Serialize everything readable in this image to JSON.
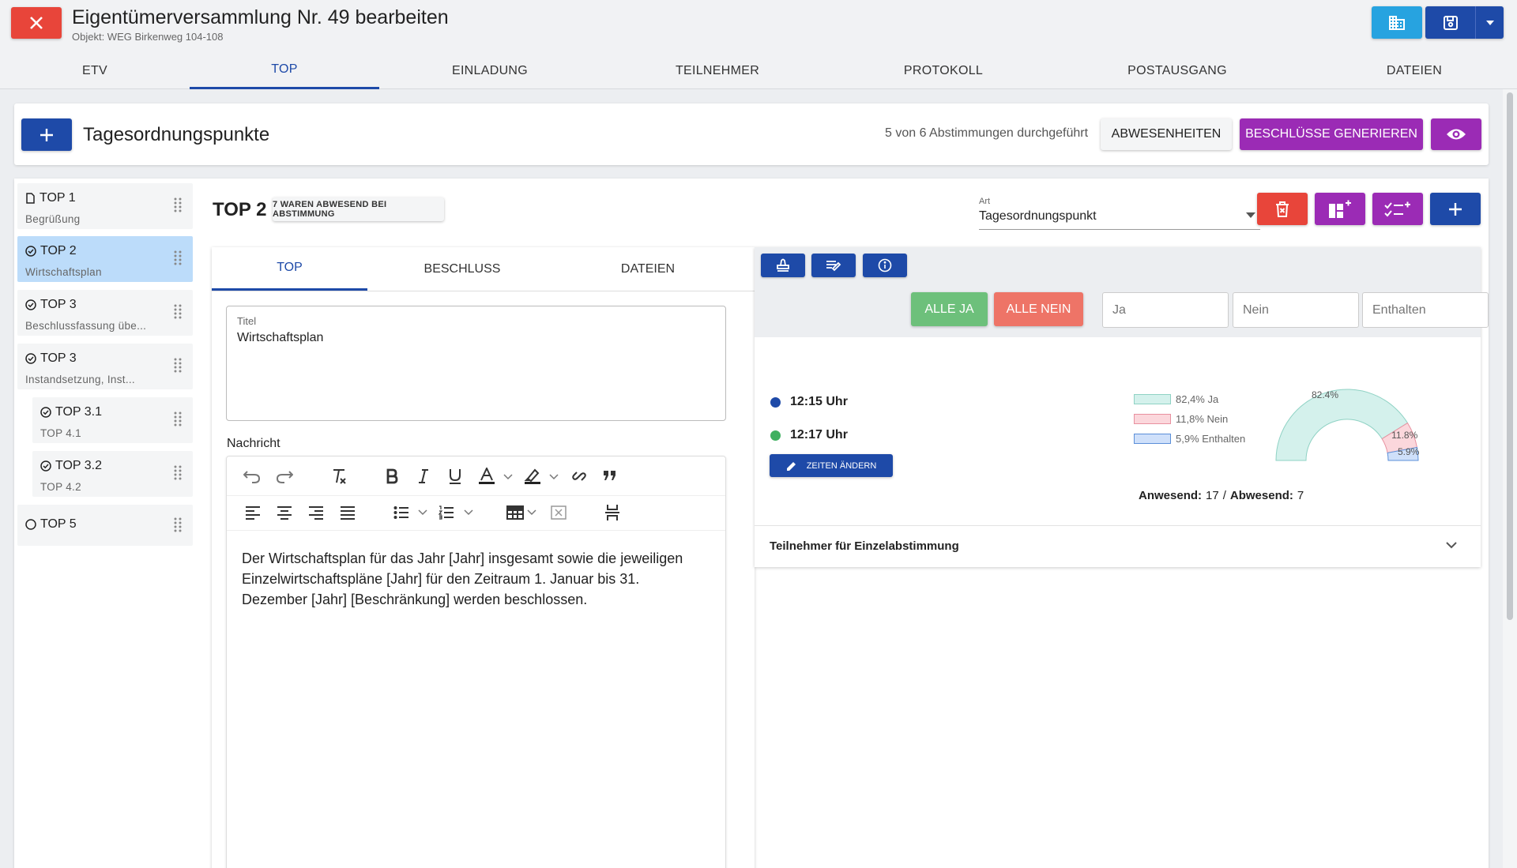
{
  "header": {
    "title": "Eigentümerversammlung Nr. 49 bearbeiten",
    "subtitle": "Objekt: WEG Birkenweg 104-108",
    "buttons": {
      "building_icon": "building-icon",
      "save_icon": "save-icon",
      "dropdown_icon": "caret-down-icon"
    }
  },
  "nav": {
    "tabs": [
      {
        "label": "ETV"
      },
      {
        "label": "TOP"
      },
      {
        "label": "EINLADUNG"
      },
      {
        "label": "TEILNEHMER"
      },
      {
        "label": "PROTOKOLL"
      },
      {
        "label": "POSTAUSGANG"
      },
      {
        "label": "DATEIEN"
      }
    ],
    "active": "TOP"
  },
  "toolbar": {
    "title": "Tagesordnungspunkte",
    "status": "5 von 6 Abstimmungen durchgeführt",
    "absences_label": "ABWESENHEITEN",
    "generate_label": "BESCHLÜSSE GENERIEREN"
  },
  "sidebar": {
    "items": [
      {
        "label": "TOP 1",
        "sub": "Begrüßung",
        "icon": "document-icon"
      },
      {
        "label": "TOP 2",
        "sub": "Wirtschaftsplan",
        "icon": "check-circle-icon",
        "active": true
      },
      {
        "label": "TOP 3",
        "sub": "Beschlussfassung übe...",
        "icon": "check-circle-icon"
      },
      {
        "label": "TOP 3",
        "sub": "Instandsetzung, Inst...",
        "icon": "check-circle-icon"
      },
      {
        "label": "TOP 3.1",
        "sub": "TOP 4.1",
        "icon": "check-circle-icon"
      },
      {
        "label": "TOP 3.2",
        "sub": "TOP 4.2",
        "icon": "check-circle-icon"
      },
      {
        "label": "TOP 5",
        "sub": "",
        "icon": "circle-icon"
      }
    ]
  },
  "detail": {
    "title": "TOP 2",
    "absent_chip": "7 WAREN ABWESEND BEI ABSTIMMUNG",
    "art_label": "Art",
    "art_value": "Tagesordnungspunkt",
    "tabs": [
      {
        "label": "TOP"
      },
      {
        "label": "BESCHLUSS"
      },
      {
        "label": "DATEIEN"
      }
    ],
    "title_field_label": "Titel",
    "title_field_value": "Wirtschaftsplan",
    "message_label": "Nachricht",
    "message_text": "Der Wirtschaftsplan für das Jahr [Jahr] insgesamt sowie die jeweiligen Einzelwirtschaftspläne [Jahr] für den Zeitraum 1. Januar bis 31. Dezember [Jahr] [Beschränkung] werden beschlossen."
  },
  "voting": {
    "all_yes": "ALLE JA",
    "all_no": "ALLE NEIN",
    "placeholders": {
      "yes": "Ja",
      "no": "Nein",
      "abstain": "Enthalten"
    },
    "time_start": "12:15 Uhr",
    "time_end": "12:17 Uhr",
    "change_times": "ZEITEN ÄNDERN",
    "present_label": "Anwesend:",
    "present_value": "17",
    "absent_label": "Abwesend:",
    "absent_value": "7",
    "separator": "/",
    "participants_label": "Teilnehmer für Einzelabstimmung",
    "colors": {
      "yes": "#d4f1ec",
      "no": "#fbd7dc",
      "abstain": "#cfe0fa",
      "start_dot": "#1e4aa8",
      "end_dot": "#3fb060"
    }
  },
  "chart_data": {
    "type": "pie",
    "variant": "half-donut",
    "series": [
      {
        "name": "Ja",
        "value": 82.4
      },
      {
        "name": "Nein",
        "value": 11.8
      },
      {
        "name": "Enthalten",
        "value": 5.9
      }
    ],
    "legend": [
      "82,4% Ja",
      "11,8% Nein",
      "5,9% Enthalten"
    ],
    "data_labels": [
      "82.4%",
      "11.8%",
      "5.9%"
    ],
    "legend_position": "left"
  },
  "colors": {
    "primary": "#1e4aa8",
    "danger": "#e8453a",
    "purple": "#9b2bb5",
    "light_blue": "#27a3e0",
    "green": "#6dc07b",
    "salmon": "#ee7467"
  }
}
